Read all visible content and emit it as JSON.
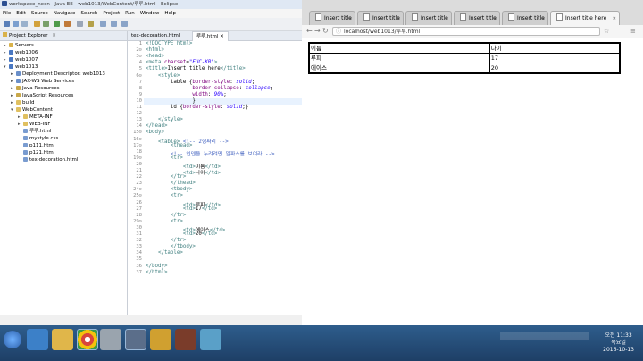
{
  "eclipse": {
    "title": "workspace_neon - Java EE - web1013/WebContent/루루.html - Eclipse",
    "menu": [
      "File",
      "Edit",
      "Source",
      "Navigate",
      "Search",
      "Project",
      "Run",
      "Window",
      "Help"
    ],
    "explorer_title": "Project Explorer",
    "tree": [
      {
        "label": "Servers",
        "depth": 0,
        "arrow": "▸",
        "color": "#d9b24a"
      },
      {
        "label": "web1006",
        "depth": 0,
        "arrow": "▸",
        "color": "#4a78c2"
      },
      {
        "label": "web1007",
        "depth": 0,
        "arrow": "▸",
        "color": "#4a78c2"
      },
      {
        "label": "web1013",
        "depth": 0,
        "arrow": "▾",
        "color": "#4a78c2"
      },
      {
        "label": "Deployment Descriptor: web1013",
        "depth": 1,
        "arrow": "▸",
        "color": "#6a8fc9"
      },
      {
        "label": "JAX-WS Web Services",
        "depth": 1,
        "arrow": "▸",
        "color": "#6a8fc9"
      },
      {
        "label": "Java Resources",
        "depth": 1,
        "arrow": "▸",
        "color": "#c9a84a"
      },
      {
        "label": "JavaScript Resources",
        "depth": 1,
        "arrow": "▸",
        "color": "#c9a84a"
      },
      {
        "label": "build",
        "depth": 1,
        "arrow": "▸",
        "color": "#e0c060"
      },
      {
        "label": "WebContent",
        "depth": 1,
        "arrow": "▾",
        "color": "#e0c060"
      },
      {
        "label": "META-INF",
        "depth": 2,
        "arrow": "▸",
        "color": "#e0c060"
      },
      {
        "label": "WEB-INF",
        "depth": 2,
        "arrow": "▸",
        "color": "#e0c060"
      },
      {
        "label": "루루.html",
        "depth": 2,
        "arrow": "",
        "color": "#7a9cd0"
      },
      {
        "label": "mystyle.css",
        "depth": 2,
        "arrow": "",
        "color": "#7a9cd0"
      },
      {
        "label": "p111.html",
        "depth": 2,
        "arrow": "",
        "color": "#7a9cd0"
      },
      {
        "label": "p121.html",
        "depth": 2,
        "arrow": "",
        "color": "#7a9cd0"
      },
      {
        "label": "tex-decoration.html",
        "depth": 2,
        "arrow": "",
        "color": "#7a9cd0"
      }
    ],
    "editor_tabs": [
      "tex-decoration.html",
      "루루.html"
    ],
    "line_numbers": [
      "1",
      "2⊝",
      "3⊝",
      "4",
      "5",
      "6⊝",
      "7",
      "8",
      "9",
      "10",
      "11",
      "12",
      "13",
      "14",
      "15⊝",
      "16⊝",
      "17⊝",
      "18",
      "19⊝",
      "20",
      "21",
      "22",
      "23",
      "24⊝",
      "25⊝",
      "26",
      "27",
      "28",
      "29⊝",
      "30",
      "31",
      "32",
      "33",
      "34",
      "35",
      "36",
      "37"
    ]
  },
  "chrome": {
    "tab_label": "Insert title",
    "tab_count": 5,
    "active_tab_label": "Insert title here",
    "url": "localhost/web1013/루루.html",
    "table": [
      [
        "이름",
        "나이"
      ],
      [
        "루피",
        "17"
      ],
      [
        "에이스",
        "20"
      ]
    ]
  },
  "taskbar": {
    "time": "오전 11:33",
    "weekday": "목요일",
    "date": "2016-10-13"
  }
}
